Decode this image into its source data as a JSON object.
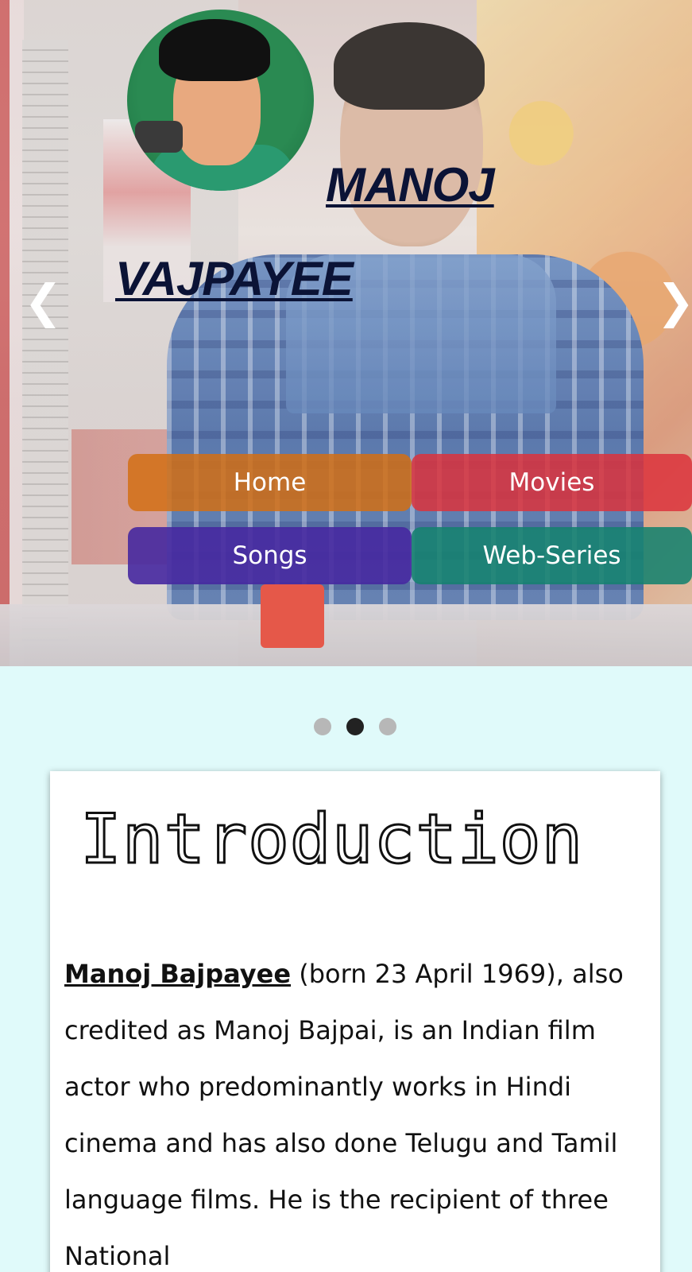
{
  "hero": {
    "title_line1": "MANOJ",
    "title_line2": "VAJPAYEE",
    "prev_arrow": "❮",
    "next_arrow": "❯",
    "avatar_icon": "manoj-cartoon-avatar",
    "background_icon": "manoj-vajpayee-photo"
  },
  "nav": {
    "home": "Home",
    "movies": "Movies",
    "songs": "Songs",
    "web_series": "Web-Series",
    "colors": {
      "home": "#d26e14",
      "movies": "#dc323c",
      "songs": "#4628a0",
      "web_series": "#14826e"
    }
  },
  "carousel": {
    "slide_count": 3,
    "active_index": 1
  },
  "intro": {
    "heading": "Introduction",
    "name_link": "Manoj Bajpayee",
    "text": " (born 23 April 1969), also credited as Manoj Bajpai, is an Indian film actor who predominantly works in Hindi cinema and has also done Telugu and Tamil language films. He is the recipient of three National"
  },
  "theme": {
    "page_background": "#e0fafa",
    "title_color": "#0b1336"
  }
}
